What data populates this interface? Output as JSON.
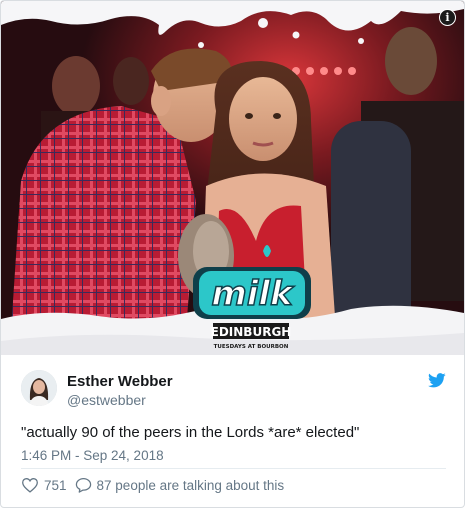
{
  "tweet": {
    "author_name": "Esther Webber",
    "author_handle": "@estwebber",
    "text": "\"actually 90 of the peers in the Lords *are* elected\"",
    "timestamp": "1:46 PM - Sep 24, 2018",
    "like_count": "751",
    "talking_text": "87 people are talking about this"
  },
  "media": {
    "logo_text": "milk",
    "logo_city": "EDINBURGH",
    "logo_tagline": "TUESDAYS AT BOURBON",
    "info_icon": "i"
  },
  "icons": {
    "info": "info-icon",
    "twitter": "twitter-bird-icon",
    "like": "heart-icon",
    "reply": "speech-bubble-icon"
  },
  "colors": {
    "twitter_blue": "#1da1f2",
    "text_primary": "#14171a",
    "text_secondary": "#657786",
    "logo_teal": "#2cc7c9"
  }
}
